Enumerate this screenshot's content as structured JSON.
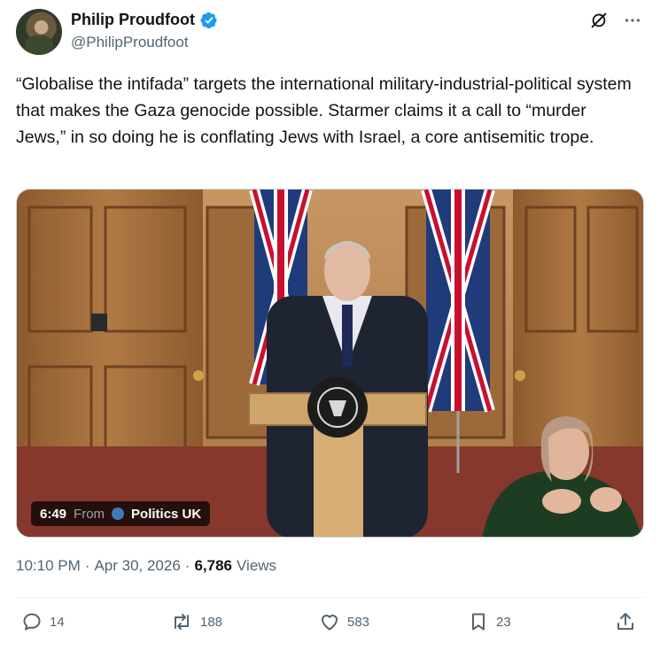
{
  "author": {
    "display_name": "Philip Proudfoot",
    "handle": "@PhilipProudfoot",
    "verified": true
  },
  "tweet": {
    "text": "“Globalise the intifada” targets the international military-industrial-political system that makes the Gaza genocide possible. Starmer claims it a call to “murder Jews,” in so doing he is conflating Jews with Israel, a core antisemitic trope."
  },
  "media": {
    "duration": "6:49",
    "from_label": "From",
    "source": "Politics UK"
  },
  "meta": {
    "time": "10:10 PM",
    "separator": "·",
    "date": "Apr 30, 2026",
    "views_count": "6,786",
    "views_label": "Views"
  },
  "actions": {
    "replies": "14",
    "reposts": "188",
    "likes": "583",
    "bookmarks": "23"
  },
  "icons": [
    "grok-icon",
    "more-icon",
    "verified-icon",
    "reply-icon",
    "repost-icon",
    "like-icon",
    "bookmark-icon",
    "share-icon"
  ],
  "colors": {
    "accent": "#1d9bf0",
    "secondary_text": "#536471",
    "text": "#0f1419"
  }
}
